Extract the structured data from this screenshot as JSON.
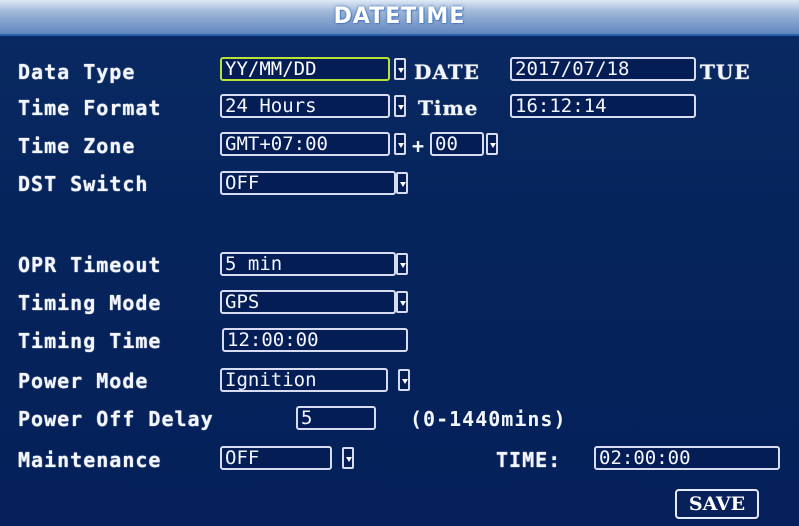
{
  "title": "DATETIME",
  "labels": {
    "data_type": "Data Type",
    "time_format": "Time Format",
    "time_zone": "Time Zone",
    "dst_switch": "DST Switch",
    "opr_timeout": "OPR Timeout",
    "timing_mode": "Timing Mode",
    "timing_time": "Timing Time",
    "power_mode": "Power Mode",
    "power_off_delay": "Power Off Delay",
    "maintenance": "Maintenance",
    "date": "DATE",
    "time": "Time",
    "maint_time": "TIME:"
  },
  "values": {
    "data_type": "YY/MM/DD",
    "time_format": "24 Hours",
    "time_zone": "GMT+07:00",
    "tz_sign": "+",
    "tz_minutes": "00",
    "dst_switch": "OFF",
    "date": "2017/07/18",
    "weekday": "TUE",
    "time": "16:12:14",
    "opr_timeout": "5 min",
    "timing_mode": "GPS",
    "timing_time": "12:00:00",
    "power_mode": "Ignition",
    "power_off_delay": "5",
    "power_off_range": "(0-1440mins)",
    "maintenance": "OFF",
    "maint_time": "02:00:00"
  },
  "buttons": {
    "save": "SAVE"
  },
  "colors": {
    "background": "#05205a",
    "focus_border": "#b8e23a",
    "field_border": "#d7dcf0"
  }
}
